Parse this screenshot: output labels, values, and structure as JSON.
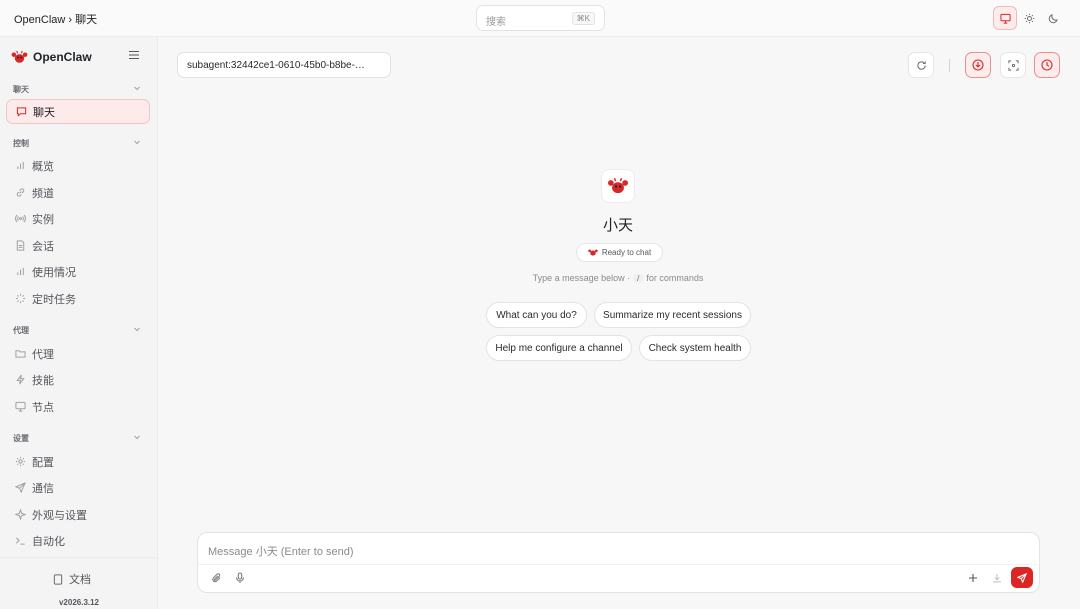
{
  "header": {
    "breadcrumb": "OpenClaw › 聊天",
    "search_placeholder": "搜索",
    "search_shortcut": "⌘K",
    "theme_options": [
      "monitor-icon",
      "sun-icon",
      "moon-icon"
    ],
    "active_theme": "monitor-icon"
  },
  "sidebar": {
    "brand": "OpenClaw",
    "sections": [
      {
        "label": "聊天",
        "items": [
          {
            "label": "聊天",
            "icon": "chat-icon",
            "active": true
          }
        ]
      },
      {
        "label": "控制",
        "items": [
          {
            "label": "概览",
            "icon": "bar-chart-icon"
          },
          {
            "label": "频道",
            "icon": "link-icon"
          },
          {
            "label": "实例",
            "icon": "broadcast-icon"
          },
          {
            "label": "会话",
            "icon": "file-icon"
          },
          {
            "label": "使用情况",
            "icon": "bar-chart-icon"
          },
          {
            "label": "定时任务",
            "icon": "loader-icon"
          }
        ]
      },
      {
        "label": "代理",
        "items": [
          {
            "label": "代理",
            "icon": "folder-icon"
          },
          {
            "label": "技能",
            "icon": "zap-icon"
          },
          {
            "label": "节点",
            "icon": "monitor-icon"
          }
        ]
      },
      {
        "label": "设置",
        "items": [
          {
            "label": "配置",
            "icon": "gear-icon"
          },
          {
            "label": "通信",
            "icon": "send-icon"
          },
          {
            "label": "外观与设置",
            "icon": "sparkle-icon"
          },
          {
            "label": "自动化",
            "icon": "terminal-icon"
          }
        ]
      }
    ],
    "docs_label": "文档",
    "version": "v2026.3.12"
  },
  "main": {
    "session": "subagent:32442ce1-0610-45b0-b8be-…",
    "agent_name": "小天",
    "status": "Ready to chat",
    "hint_before": "Type a message below ·",
    "hint_key": "/",
    "hint_after": "for commands",
    "suggestions": [
      "What can you do?",
      "Summarize my recent sessions",
      "Help me configure a channel",
      "Check system health"
    ],
    "composer_placeholder": "Message 小天 (Enter to send)"
  },
  "colors": {
    "accent": "#dc2626",
    "accent_soft": "#fdecec"
  }
}
